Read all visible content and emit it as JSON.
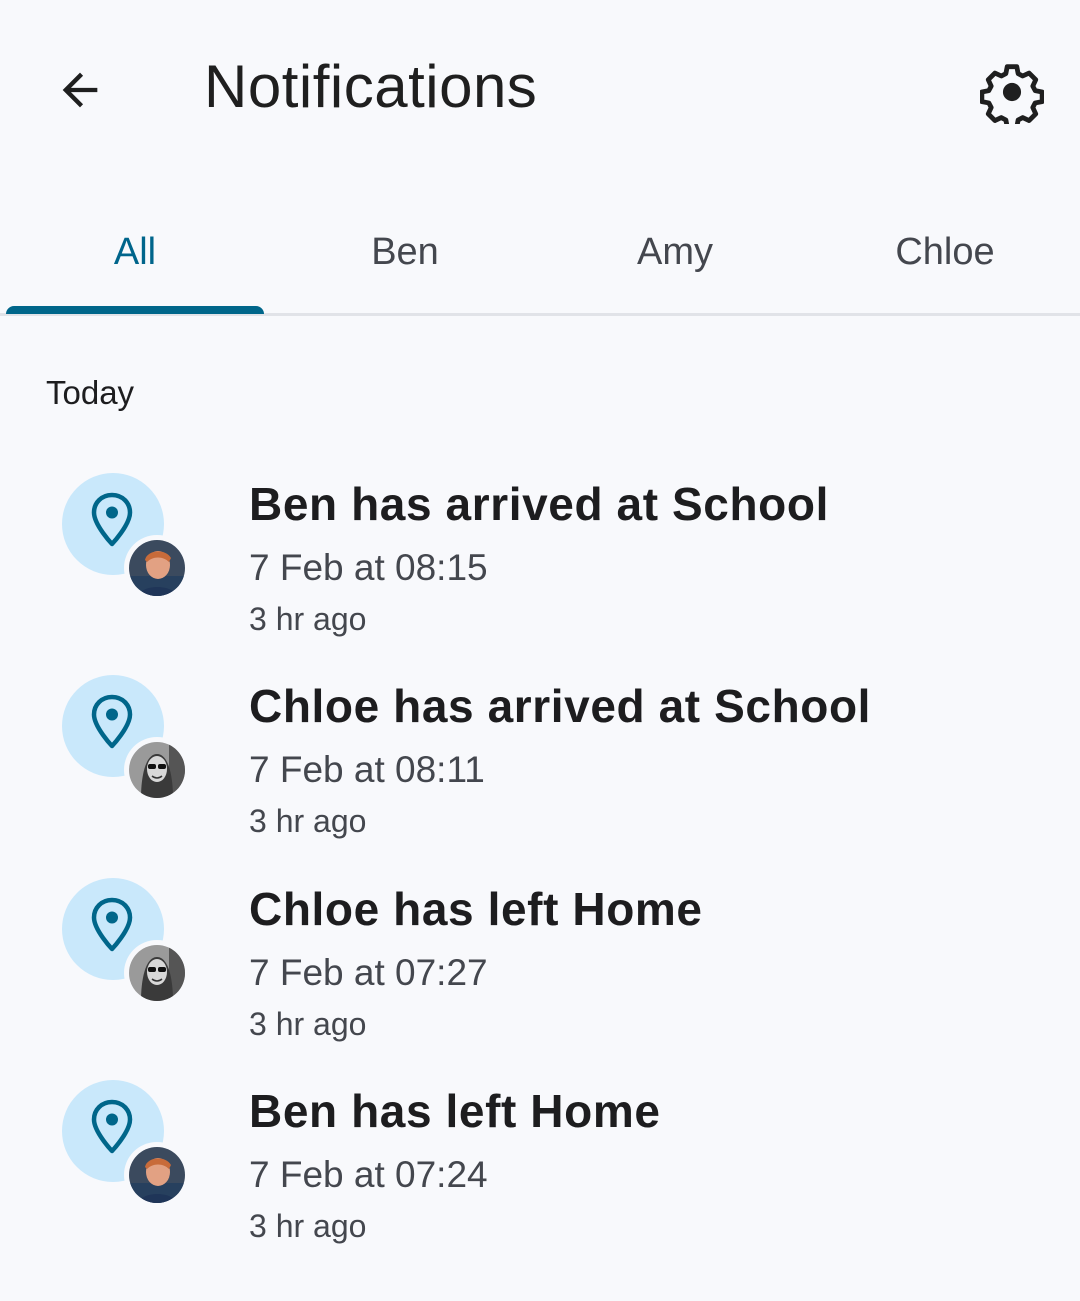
{
  "header": {
    "title": "Notifications",
    "back_icon": "arrow-left-icon",
    "settings_icon": "gear-icon"
  },
  "tabs": [
    {
      "label": "All",
      "active": true
    },
    {
      "label": "Ben",
      "active": false
    },
    {
      "label": "Amy",
      "active": false
    },
    {
      "label": "Chloe",
      "active": false
    }
  ],
  "section": {
    "label": "Today"
  },
  "notifications": [
    {
      "title": "Ben has arrived at School",
      "date": "7 Feb at 08:15",
      "ago": "3 hr ago",
      "icon": "location-pin-icon",
      "avatar": "ben-avatar"
    },
    {
      "title": "Chloe has arrived at School",
      "date": "7 Feb at 08:11",
      "ago": "3 hr ago",
      "icon": "location-pin-icon",
      "avatar": "chloe-avatar"
    },
    {
      "title": "Chloe has left Home",
      "date": "7 Feb at 07:27",
      "ago": "3 hr ago",
      "icon": "location-pin-icon",
      "avatar": "chloe-avatar"
    },
    {
      "title": "Ben has left Home",
      "date": "7 Feb at 07:24",
      "ago": "3 hr ago",
      "icon": "location-pin-icon",
      "avatar": "ben-avatar"
    }
  ],
  "colors": {
    "accent": "#00668a",
    "background": "#f8f9fc",
    "icon_bg": "#c9e8fb",
    "secondary_text": "#44474e"
  }
}
